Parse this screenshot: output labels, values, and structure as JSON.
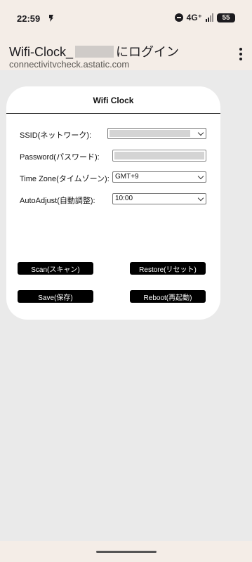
{
  "status_bar": {
    "time": "22:59",
    "network": "4G⁺",
    "battery": "55",
    "icons": [
      "app-notification-icon",
      "do-not-disturb-icon",
      "signal-icon",
      "battery-icon"
    ]
  },
  "browser": {
    "title_prefix": "Wifi-Clock_",
    "title_suffix": "にログイン",
    "url": "connectivitvcheck.astatic.com",
    "menu_icon": "more-vert-icon"
  },
  "card": {
    "title": "Wifi Clock",
    "fields": {
      "ssid": {
        "label": "SSID(ネットワーク):",
        "value": ""
      },
      "password": {
        "label": "Password(パスワード):",
        "value": ""
      },
      "timezone": {
        "label": "Time Zone(タイムゾーン):",
        "value": "GMT+9"
      },
      "autoadjust": {
        "label": "AutoAdjust(自動調整):",
        "value": "10:00"
      }
    },
    "buttons": {
      "scan": "Scan(スキャン)",
      "restore": "Restore(リセット)",
      "save": "Save(保存)",
      "reboot": "Reboot(再起動)"
    }
  },
  "colors": {
    "page_background": "#eaeaea",
    "chrome_background": "#f4ede7",
    "card_background": "#ffffff",
    "button_background": "#000000",
    "button_text": "#ffffff"
  }
}
